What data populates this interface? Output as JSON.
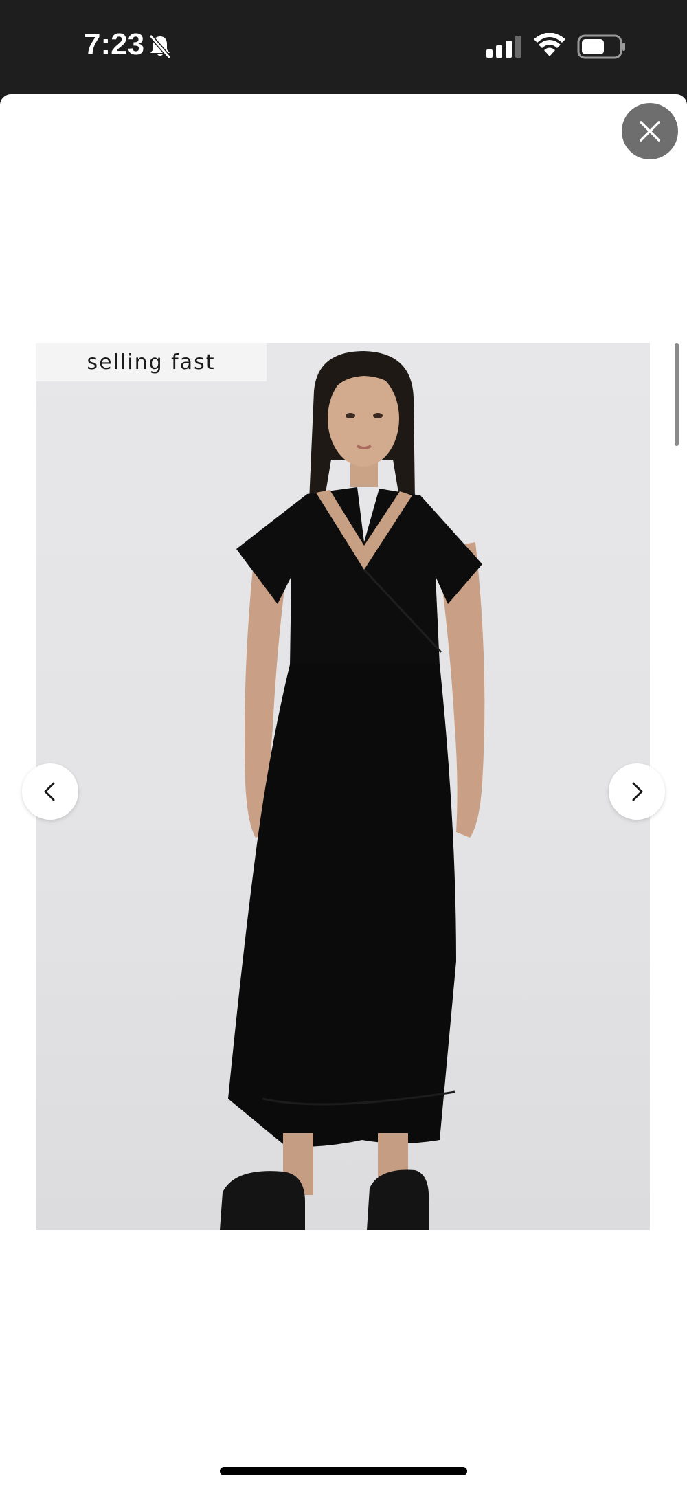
{
  "status_bar": {
    "time": "7:23",
    "icons": [
      "bell-slash-icon",
      "cellular-signal-icon",
      "wifi-icon",
      "battery-icon"
    ]
  },
  "viewer": {
    "close_icon": "close-icon",
    "badge_label": "selling fast",
    "prev_icon": "chevron-left-icon",
    "next_icon": "chevron-right-icon"
  },
  "colors": {
    "status_bar_bg": "#1e1e1e",
    "sheet_bg": "#ffffff",
    "close_button_bg": "#6e6e6e",
    "photo_bg": "#e5e5e7",
    "dress": "#0d0d0d"
  }
}
